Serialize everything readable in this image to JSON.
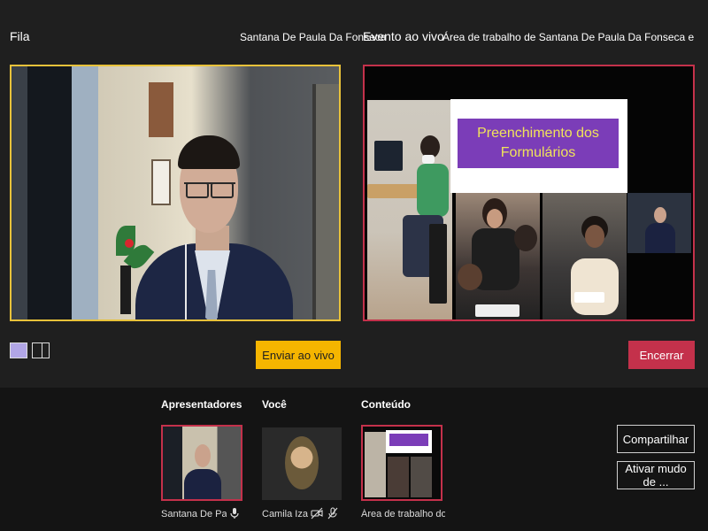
{
  "queue": {
    "title": "Fila",
    "presenter_name": "Santana De Paula Da Fonseca"
  },
  "live": {
    "title": "Evento ao vivo",
    "source_name": "Área de trabalho de Santana De Paula Da Fonseca e Santana De Paula ...",
    "slide_title": "Preenchimento dos Formulários"
  },
  "buttons": {
    "send_live": "Enviar ao vivo",
    "end": "Encerrar",
    "share": "Compartilhar",
    "mute": "Ativar mudo de ..."
  },
  "tray": {
    "presenters_title": "Apresentadores",
    "you_title": "Você",
    "content_title": "Conteúdo",
    "presenter_label": "Santana De Paula ...",
    "you_label": "Camila Izabel...",
    "content_label": "Área de trabalho do Sant..."
  },
  "colors": {
    "accent_yellow": "#f5b500",
    "accent_red": "#c4314b",
    "slide_purple": "#7b3db8",
    "slide_text": "#f0e35a",
    "layout_selected": "#b1a6e6"
  },
  "icons": {
    "layout_single": "single-layout-icon",
    "layout_split": "split-layout-icon",
    "mic": "microphone-icon",
    "camera_off": "camera-off-icon",
    "mic_off": "microphone-off-icon"
  }
}
